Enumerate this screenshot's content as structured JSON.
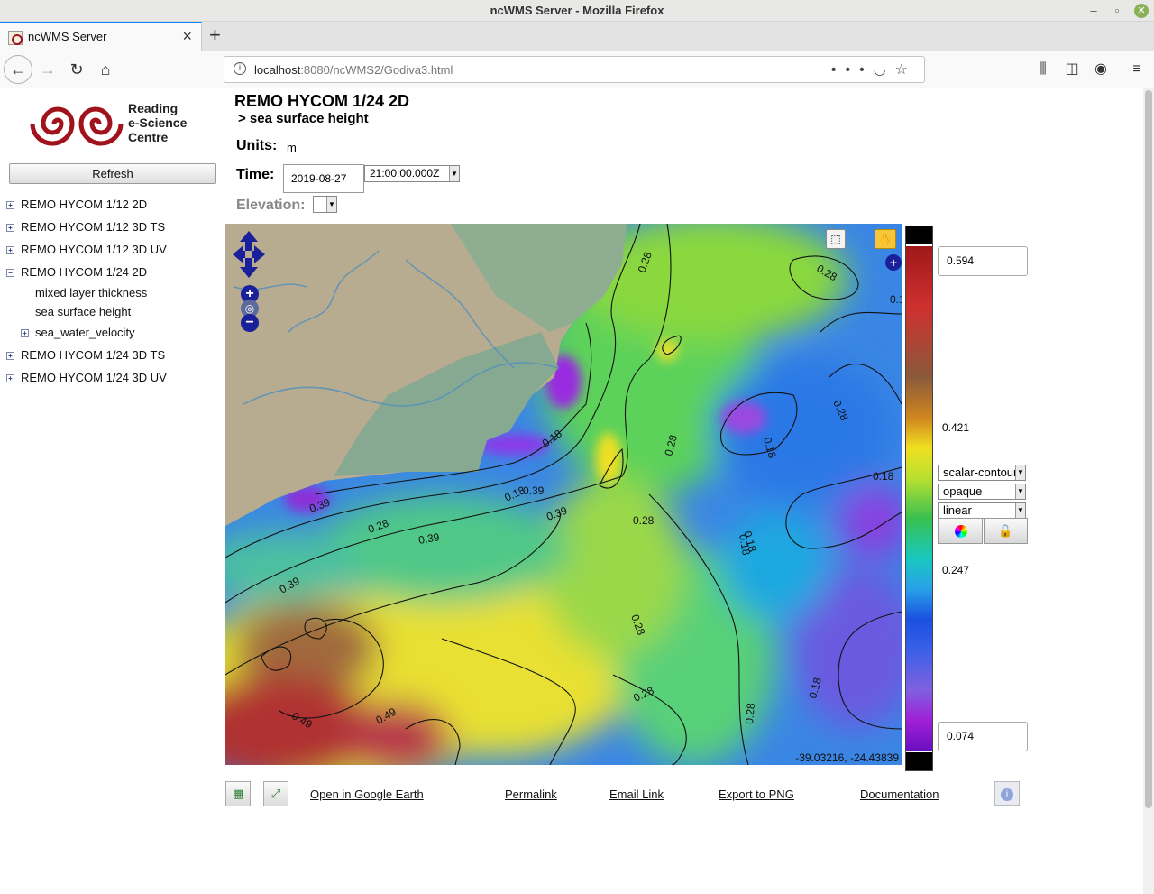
{
  "window": {
    "title": "ncWMS Server - Mozilla Firefox"
  },
  "tab": {
    "label": "ncWMS Server"
  },
  "urlbar": {
    "host": "localhost",
    "path": ":8080/ncWMS2/Godiva3.html"
  },
  "logo": {
    "line1": "Reading",
    "line2": "e-Science",
    "line3": "Centre"
  },
  "sidebar": {
    "refresh_label": "Refresh",
    "datasets": [
      {
        "label": "REMO HYCOM 1/12 2D",
        "toggle": "+"
      },
      {
        "label": "REMO HYCOM 1/12 3D TS",
        "toggle": "+"
      },
      {
        "label": "REMO HYCOM 1/12 3D UV",
        "toggle": "+"
      },
      {
        "label": "REMO HYCOM 1/24 2D",
        "toggle": "−"
      },
      {
        "label": "REMO HYCOM 1/24 3D TS",
        "toggle": "+"
      },
      {
        "label": "REMO HYCOM 1/24 3D UV",
        "toggle": "+"
      }
    ],
    "variables": [
      "mixed layer thickness",
      "sea surface height"
    ],
    "subgroup": {
      "label": "sea_water_velocity",
      "toggle": "+"
    }
  },
  "main": {
    "dataset_title": "REMO HYCOM 1/24 2D",
    "variable_title": "> sea surface height",
    "units_label": "Units:",
    "units_value": "m",
    "time_label": "Time:",
    "date_value": "2019-08-27",
    "time_value": "21:00:00.000Z",
    "elevation_label": "Elevation:"
  },
  "map": {
    "coords": "-39.03216, -24.43839",
    "contour_labels": [
      "0.28",
      "0.28",
      "0.18",
      "0.28",
      "0.18",
      "0.18",
      "0.28",
      "0.18",
      "0.28",
      "0.18",
      "0.39",
      "0.39",
      "0.39",
      "0.28",
      "0.39",
      "0.39",
      "0.49",
      "0.49",
      "0.28",
      "0.28",
      "0.18",
      "0.18",
      "0.18",
      "0.28"
    ]
  },
  "colorbar": {
    "max": "0.594",
    "min": "0.074",
    "upper_mid": "0.421",
    "lower_mid": "0.247",
    "style": "scalar-contour",
    "opacity": "opaque",
    "scale": "linear"
  },
  "footer": {
    "google_earth": "Open in Google Earth",
    "permalink": "Permalink",
    "email": "Email Link",
    "export": "Export to PNG",
    "docs": "Documentation"
  }
}
